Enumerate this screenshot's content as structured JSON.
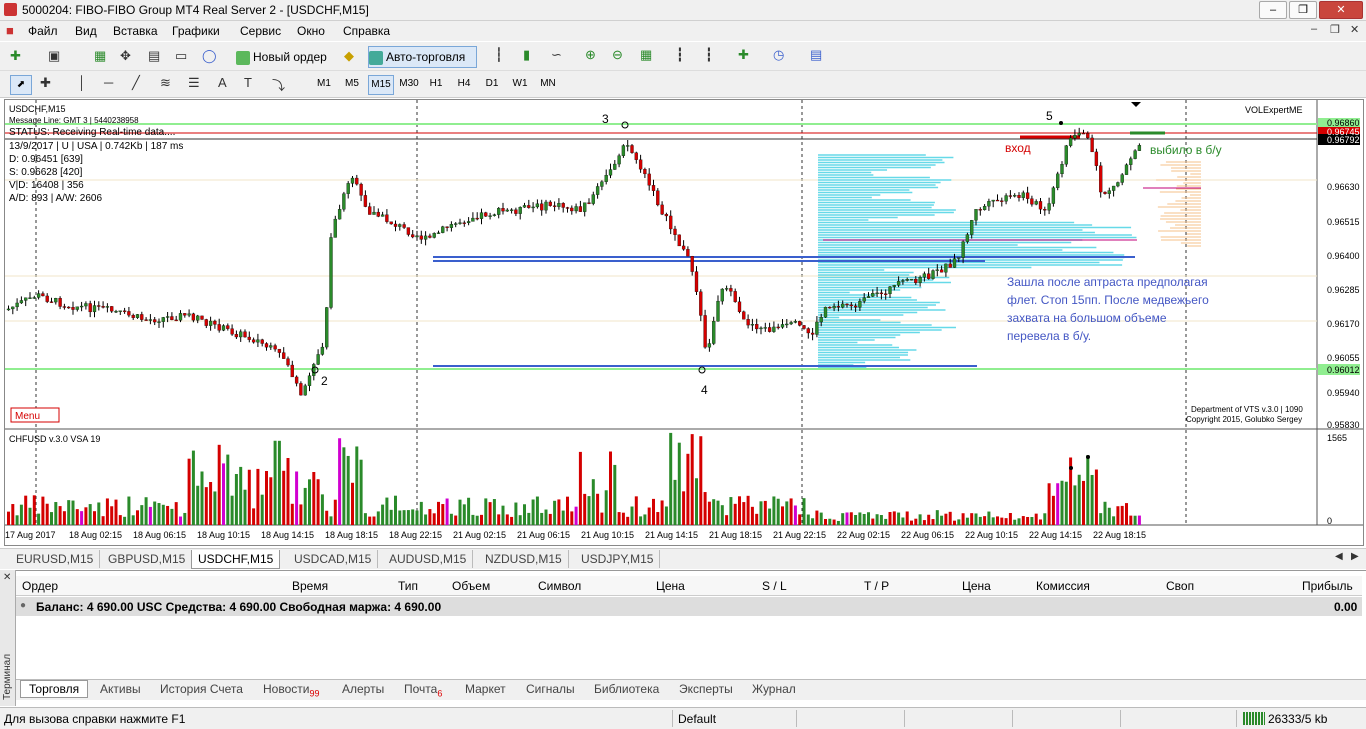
{
  "window": {
    "title": "5000204: FIBO-FIBO Group MT4 Real Server 2 - [USDCHF,M15]"
  },
  "menu": [
    "Файл",
    "Вид",
    "Вставка",
    "Графики",
    "Сервис",
    "Окно",
    "Справка"
  ],
  "toolbar": {
    "new_order_label": "Новый ордер",
    "autotrading_label": "Авто-торговля"
  },
  "timeframes": [
    "M1",
    "M5",
    "M15",
    "M30",
    "H1",
    "H4",
    "D1",
    "W1",
    "MN"
  ],
  "active_timeframe": "M15",
  "chart": {
    "symbol": "USDCHF,M15",
    "message_line": "Message Line: GMT 3 | 5440238958",
    "status_line": "STATUS:  Receiving Real-time data....",
    "info_lines": [
      "13/9/2017 | U | USA | 0.742Kb | 187 ms",
      "D: 0.96451  [639]",
      "S: 0.96628  [420]",
      "V|D: 16408 | 356",
      "A/D: 893 | A/W: 2606"
    ],
    "vol_expert": "VOLExpertME",
    "menu_button": "Menu",
    "copyright_1": "Department of VTS  v.3.0 | 1090",
    "copyright_2": "Copyright 2015, Golubko Sergey",
    "label_entry": "вход",
    "label_be": "выбило в б/у",
    "annotation": [
      "Зашла после аптраста предполагая",
      "флет. Стоп 15пп. После медвежьего",
      "захвата на большом объеме",
      "перевела в б/у."
    ],
    "markers": [
      "2",
      "3",
      "4",
      "5"
    ],
    "indicator_title": "CHFUSD v.3.0 VSA 19",
    "indicator_max": "1565",
    "indicator_min": "0",
    "price_labels": [
      "0.96860",
      "0.96792",
      "0.96745",
      "0.96630",
      "0.96515",
      "0.96400",
      "0.96285",
      "0.96170",
      "0.96055",
      "0.96012",
      "0.95940",
      "0.95830"
    ],
    "time_labels": [
      "17 Aug 2017",
      "18 Aug 02:15",
      "18 Aug 06:15",
      "18 Aug 10:15",
      "18 Aug 14:15",
      "18 Aug 18:15",
      "18 Aug 22:15",
      "21 Aug 02:15",
      "21 Aug 06:15",
      "21 Aug 10:15",
      "21 Aug 14:15",
      "21 Aug 18:15",
      "21 Aug 22:15",
      "22 Aug 02:15",
      "22 Aug 06:15",
      "22 Aug 10:15",
      "22 Aug 14:15",
      "22 Aug 18:15"
    ],
    "colors": {
      "bull": "#2a8a2a",
      "bear": "#d40000",
      "level": "#3a5fcd",
      "profile": "#66d9e8",
      "green_line": "#90ee90",
      "entry_line": "#d40000",
      "annotation": "#4457c4"
    }
  },
  "chart_tabs": [
    "EURUSD,M15",
    "GBPUSD,M15",
    "USDCHF,M15",
    "USDCAD,M15",
    "AUDUSD,M15",
    "NZDUSD,M15",
    "USDJPY,M15"
  ],
  "active_chart_tab": "USDCHF,M15",
  "terminal": {
    "side_label": "Терминал",
    "columns": [
      "Ордер",
      "Время",
      "Тип",
      "Объем",
      "Символ",
      "Цена",
      "S / L",
      "T / P",
      "Цена",
      "Комиссия",
      "Своп",
      "Прибыль"
    ],
    "balance": "Баланс: 4 690.00 USC  Средства: 4 690.00  Свободная маржа: 4 690.00",
    "profit": "0.00",
    "tabs": [
      {
        "label": "Торговля",
        "badge": ""
      },
      {
        "label": "Активы",
        "badge": ""
      },
      {
        "label": "История Счета",
        "badge": ""
      },
      {
        "label": "Новости",
        "badge": "99"
      },
      {
        "label": "Алерты",
        "badge": ""
      },
      {
        "label": "Почта",
        "badge": "6"
      },
      {
        "label": "Маркет",
        "badge": ""
      },
      {
        "label": "Сигналы",
        "badge": ""
      },
      {
        "label": "Библиотека",
        "badge": ""
      },
      {
        "label": "Эксперты",
        "badge": ""
      },
      {
        "label": "Журнал",
        "badge": ""
      }
    ]
  },
  "status": {
    "help": "Для вызова справки нажмите F1",
    "profile": "Default",
    "traffic": "26333/5 kb"
  }
}
